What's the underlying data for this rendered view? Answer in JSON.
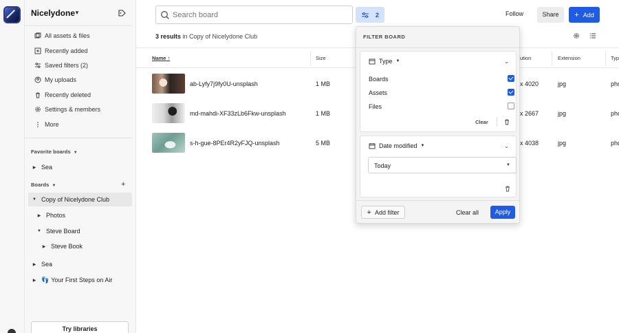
{
  "workspace": {
    "name": "Nicelydone"
  },
  "sidebar": {
    "nav": [
      {
        "label": "All assets & files",
        "icon": "assets-icon"
      },
      {
        "label": "Recently added",
        "icon": "plus-square-icon"
      },
      {
        "label": "Saved filters (2)",
        "icon": "filter-icon"
      },
      {
        "label": "My uploads",
        "icon": "user-icon"
      },
      {
        "label": "Recently deleted",
        "icon": "trash-icon"
      },
      {
        "label": "Settings & members",
        "icon": "gear-icon"
      },
      {
        "label": "More",
        "icon": "more-vertical-icon"
      }
    ],
    "favorite_heading": "Favorite boards",
    "favorites": [
      {
        "label": "Sea"
      }
    ],
    "boards_heading": "Boards",
    "boards": [
      {
        "label": "Copy of Nicelydone Club",
        "expanded": true,
        "active": true
      },
      {
        "label": "Photos"
      },
      {
        "label": "Steve Board",
        "expanded": true
      },
      {
        "label": "Steve Book"
      },
      {
        "label": "Sea"
      },
      {
        "label": "Your First Steps on Air",
        "emoji": "👣"
      }
    ],
    "try_libraries": "Try libraries"
  },
  "topbar": {
    "search_placeholder": "Search board",
    "filter_count": "2",
    "follow": "Follow",
    "share": "Share",
    "add": "Add"
  },
  "results": {
    "count": "3 results",
    "in_text": " in Copy of Nicelydone Club"
  },
  "table": {
    "columns": [
      "Name",
      "Size",
      "ution",
      "Extension",
      "Typ"
    ],
    "rows": [
      {
        "name": "ab-Lyfy7j9fy0U-unsplash",
        "size": "1 MB",
        "resolution": "x 4020",
        "extension": "jpg",
        "type": "pho"
      },
      {
        "name": "md-mahdi-XF33zLb6Fkw-unsplash",
        "size": "1 MB",
        "resolution": "x 2667",
        "extension": "jpg",
        "type": "pho"
      },
      {
        "name": "s-h-gue-8PEr4R2yFJQ-unsplash",
        "size": "5 MB",
        "resolution": "x 4038",
        "extension": "jpg",
        "type": "pho"
      }
    ]
  },
  "filter_panel": {
    "title": "FILTER BOARD",
    "type_label": "Type",
    "options": [
      {
        "label": "Boards",
        "checked": true
      },
      {
        "label": "Assets",
        "checked": true
      },
      {
        "label": "Files",
        "checked": false
      }
    ],
    "clear": "Clear",
    "date_label": "Date modified",
    "date_value": "Today",
    "add_filter": "Add filter",
    "clear_all": "Clear all",
    "apply": "Apply"
  },
  "colors": {
    "accent": "#1f5ce6",
    "filter_bg": "#d4e3fb"
  }
}
